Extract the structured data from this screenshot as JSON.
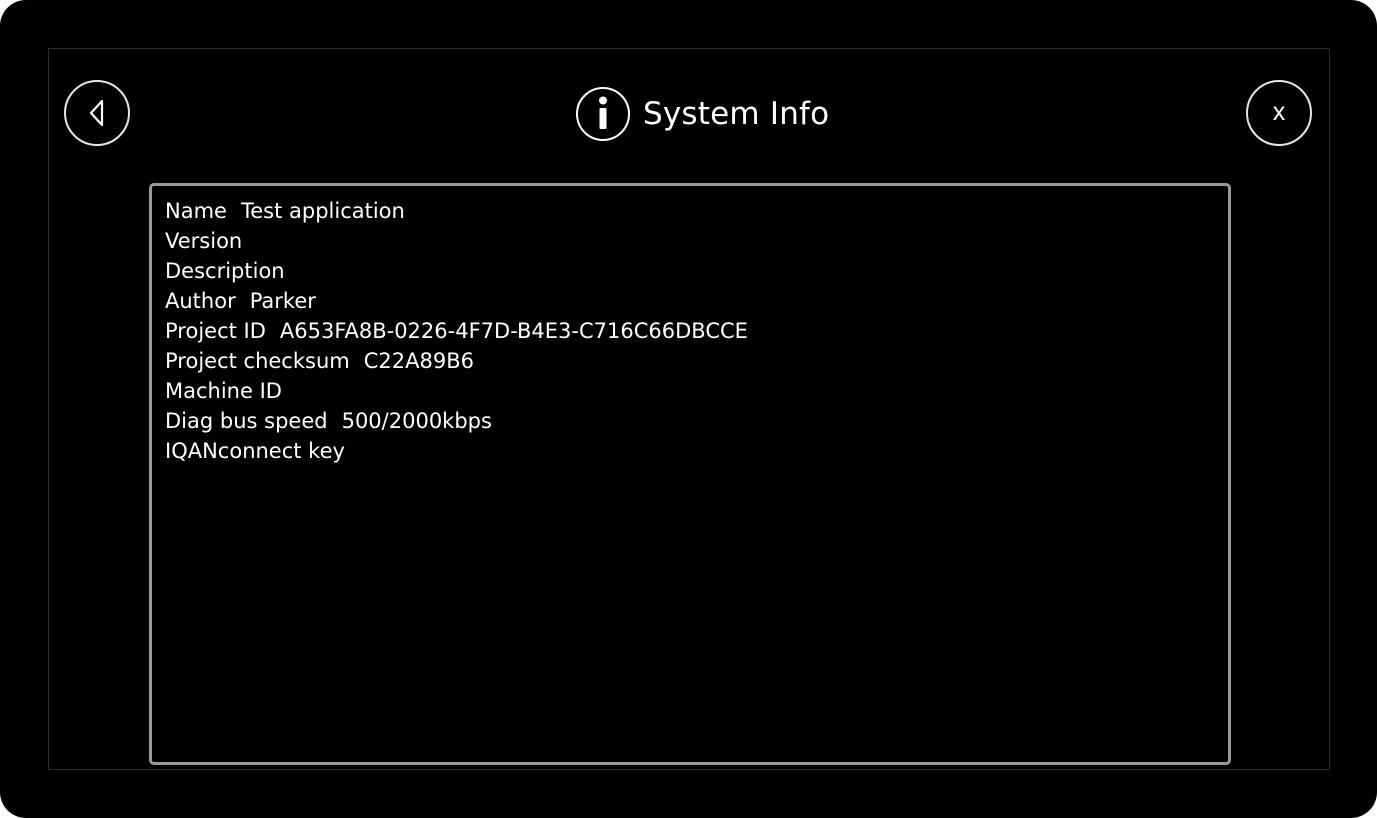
{
  "header": {
    "title": "System Info",
    "close_label": "x"
  },
  "icons": {
    "back": "chevron-left-icon",
    "info": "info-icon",
    "close": "close-icon"
  },
  "info_rows": [
    {
      "label": "Name",
      "value": "Test application"
    },
    {
      "label": "Version",
      "value": ""
    },
    {
      "label": "Description",
      "value": ""
    },
    {
      "label": "Author",
      "value": "Parker"
    },
    {
      "label": "Project ID",
      "value": "A653FA8B-0226-4F7D-B4E3-C716C66DBCCE"
    },
    {
      "label": "Project checksum",
      "value": "C22A89B6"
    },
    {
      "label": "Machine ID",
      "value": ""
    },
    {
      "label": "Diag bus speed",
      "value": "500/2000kbps"
    },
    {
      "label": "IQANconnect key",
      "value": ""
    }
  ]
}
